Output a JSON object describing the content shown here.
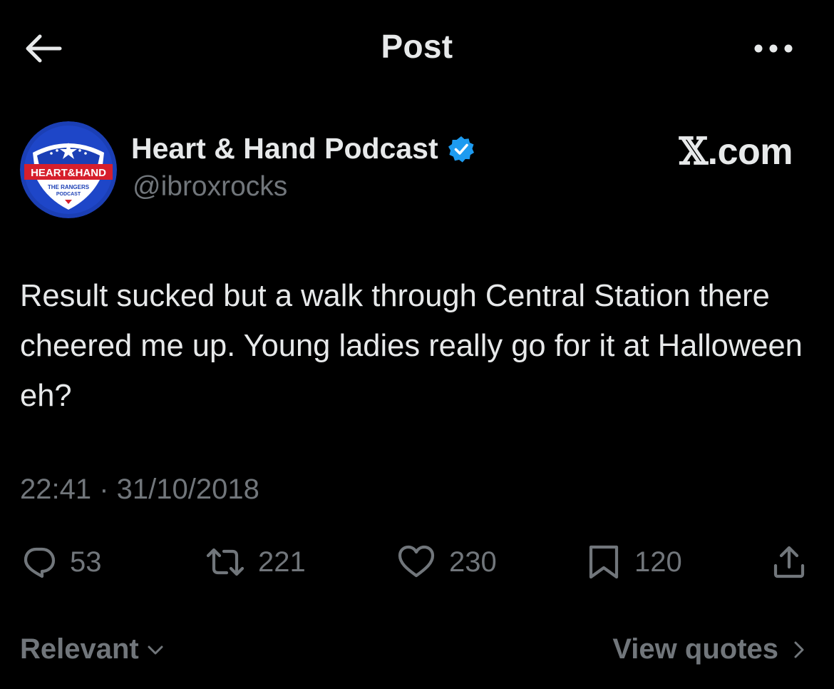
{
  "header": {
    "title": "Post",
    "back_icon": "arrow-left-icon",
    "more_icon": "more-horizontal-icon"
  },
  "author": {
    "name": "Heart & Hand Podcast",
    "handle": "@ibroxrocks",
    "verified": true,
    "avatar": {
      "icon": "heart-and-hand-logo",
      "text_main": "HEART&HAND",
      "text_sub_1": "THE RANGERS",
      "text_sub_2": "PODCAST"
    }
  },
  "watermark": {
    "x_glyph": "𝕏",
    "text": ".com"
  },
  "post": {
    "text": "Result sucked but a walk through Central Station there cheered me up. Young ladies really go for it at Halloween eh?",
    "timestamp": "22:41 · 31/10/2018"
  },
  "actions": {
    "replies": "53",
    "reposts": "221",
    "likes": "230",
    "bookmarks": "120"
  },
  "footer": {
    "sort_label": "Relevant",
    "view_quotes_label": "View quotes"
  },
  "colors": {
    "background": "#000000",
    "primary_text": "#e7e9ea",
    "secondary_text": "#71767b",
    "verified_blue": "#1d9bf0",
    "logo_blue": "#1b3fb5",
    "logo_red": "#d61f2c"
  }
}
